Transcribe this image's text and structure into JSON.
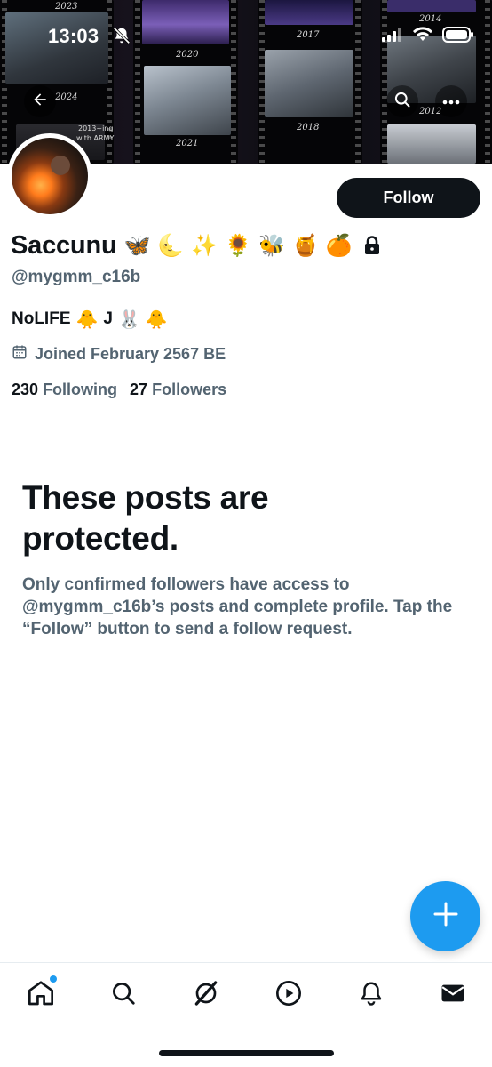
{
  "status_bar": {
    "time": "13:03"
  },
  "banner": {
    "years": [
      "2023",
      "2020",
      "2017",
      "2014",
      "2024",
      "2021",
      "2018",
      "2012"
    ],
    "caption_line1": "2013~ing",
    "caption_line2": "with ARMY"
  },
  "profile": {
    "display_name": "Saccunu",
    "name_emojis": [
      "🦋",
      "🌜",
      "✨",
      "🌻",
      "🐝",
      "🍯",
      "🍊"
    ],
    "handle": "@mygmm_c16b",
    "bio_text_1": "NoLIFE",
    "bio_emoji_1": "🐥",
    "bio_text_2": "J",
    "bio_emoji_2": "🐰",
    "bio_emoji_3": "🐥",
    "joined": "Joined February 2567 BE",
    "following_count": "230",
    "following_label": "Following",
    "followers_count": "27",
    "followers_label": "Followers"
  },
  "actions": {
    "follow_label": "Follow"
  },
  "protected": {
    "title": "These posts are protected.",
    "body": "Only confirmed followers have access to @mygmm_c16b’s posts and complete profile. Tap the “Follow” button to send a follow request."
  },
  "colors": {
    "accent": "#1d9bf0",
    "text_primary": "#0f1419",
    "text_secondary": "#536471"
  },
  "nav": {
    "items": [
      {
        "icon": "home-icon",
        "has_dot": true
      },
      {
        "icon": "search-icon"
      },
      {
        "icon": "grok-icon"
      },
      {
        "icon": "video-icon"
      },
      {
        "icon": "notifications-icon"
      },
      {
        "icon": "messages-icon"
      }
    ]
  }
}
